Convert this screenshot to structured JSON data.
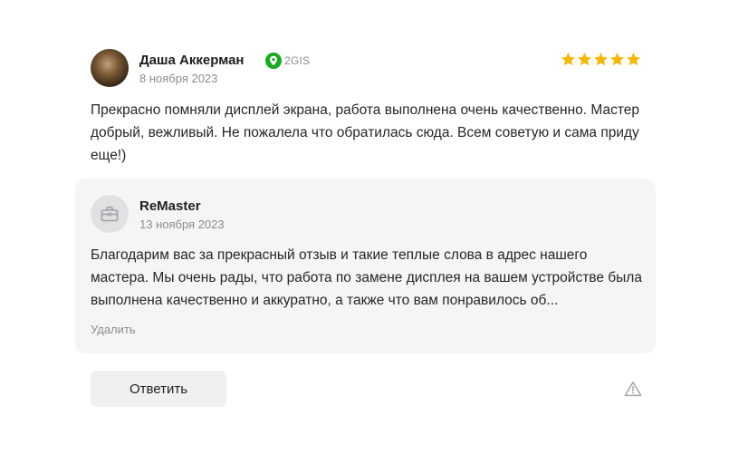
{
  "review": {
    "author": "Даша Аккерман",
    "source": "2GIS",
    "date": "8 ноября 2023",
    "rating": 5,
    "text": "Прекрасно помняли дисплей экрана, работа выполнена очень качественно. Мастер добрый, вежливый. Не пожалела что обратилась сюда. Всем советую и сама приду еще!)"
  },
  "reply": {
    "author": "ReMaster",
    "date": "13 ноября 2023",
    "text": "Благодарим вас за прекрасный отзыв и такие теплые слова в адрес нашего мастера. Мы очень рады, что работа по замене дисплея на вашем устройстве была выполнена качественно и аккуратно, а также что вам понравилось об...",
    "delete_label": "Удалить"
  },
  "actions": {
    "reply_label": "Ответить"
  },
  "icons": {
    "source": "2gis-pin-icon",
    "stars": "star-icon",
    "company": "briefcase-icon",
    "report": "warning-triangle-icon"
  },
  "colors": {
    "star": "#f5b800",
    "source_green": "#19aa1e",
    "muted_text": "#8c8c8c",
    "reply_background": "#f5f5f7"
  }
}
